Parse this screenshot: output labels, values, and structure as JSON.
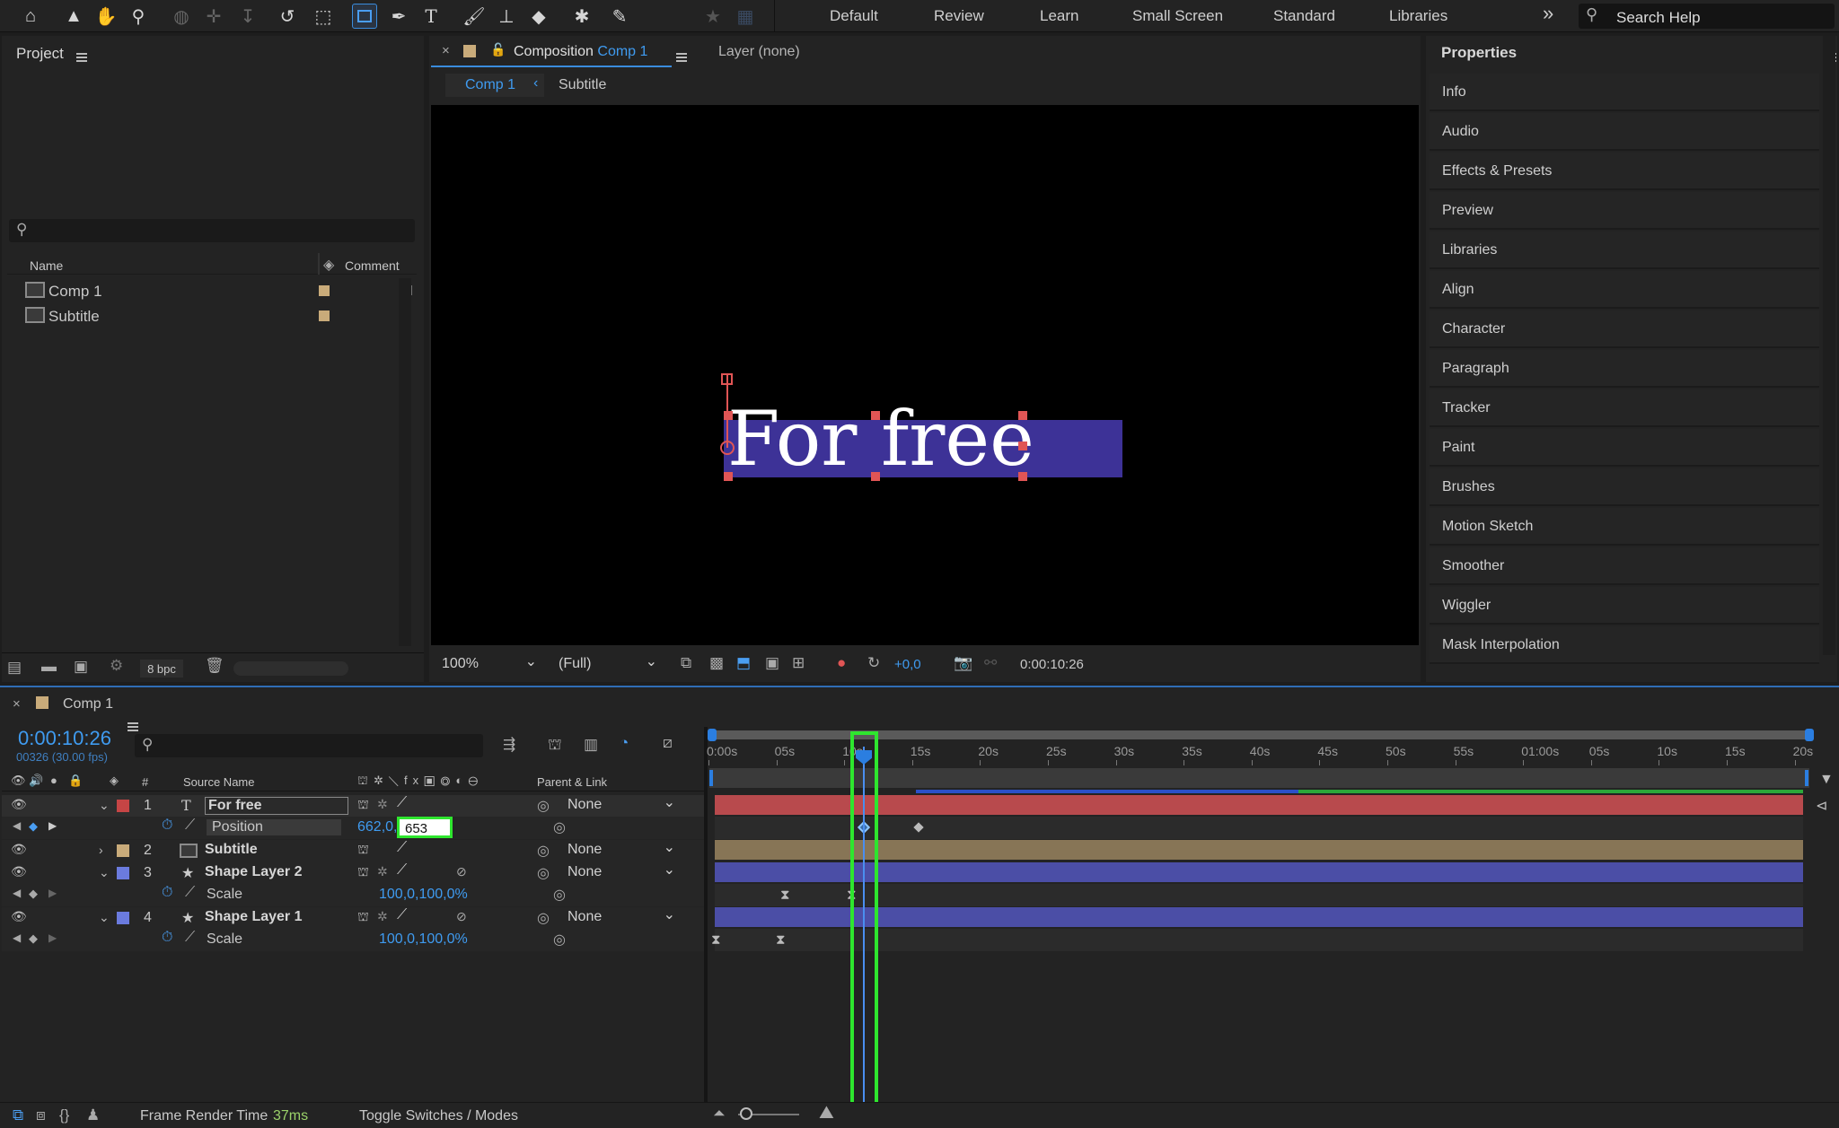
{
  "toolbar": {
    "workspaces": [
      "Default",
      "Review",
      "Learn",
      "Small Screen",
      "Standard",
      "Libraries"
    ],
    "overflow": "»",
    "search_placeholder": "Search Help"
  },
  "project": {
    "title": "Project",
    "col_name": "Name",
    "col_comment": "Comment",
    "items": [
      {
        "name": "Comp 1",
        "color": "#c9ab7a"
      },
      {
        "name": "Subtitle",
        "color": "#c9ab7a"
      }
    ],
    "bpc": "8 bpc"
  },
  "composition": {
    "tab_prefix": "Composition",
    "tab_name": "Comp 1",
    "layer_tab": "Layer (none)",
    "breadcrumb": [
      "Comp 1",
      "Subtitle"
    ],
    "viewer_text": "For free",
    "zoom": "100%",
    "resolution": "(Full)",
    "exposure": "+0,0",
    "timecode": "0:00:10:26"
  },
  "properties": {
    "title": "Properties",
    "items": [
      "Info",
      "Audio",
      "Effects & Presets",
      "Preview",
      "Libraries",
      "Align",
      "Character",
      "Paragraph",
      "Tracker",
      "Paint",
      "Brushes",
      "Motion Sketch",
      "Smoother",
      "Wiggler",
      "Mask Interpolation"
    ]
  },
  "timeline": {
    "comp_name": "Comp 1",
    "timecode": "0:00:10:26",
    "frames": "00326 (30.00 fps)",
    "col_source": "Source Name",
    "col_parent": "Parent & Link",
    "ruler": [
      "0:00s",
      "05s",
      "10s",
      "15s",
      "20s",
      "25s",
      "30s",
      "35s",
      "40s",
      "45s",
      "50s",
      "55s",
      "01:00s",
      "05s",
      "10s",
      "15s",
      "20s"
    ],
    "layers": [
      {
        "num": "1",
        "name": "For free",
        "type": "T",
        "color": "#c64545",
        "parent": "None"
      },
      {
        "prop": "Position",
        "value": "662,0,",
        "edit": "653"
      },
      {
        "num": "2",
        "name": "Subtitle",
        "type": "comp",
        "color": "#c9ab7a",
        "parent": "None"
      },
      {
        "num": "3",
        "name": "Shape Layer 2",
        "type": "★",
        "color": "#6b7bde",
        "parent": "None"
      },
      {
        "prop": "Scale",
        "value": "100,0,100,0%"
      },
      {
        "num": "4",
        "name": "Shape Layer 1",
        "type": "★",
        "color": "#6b7bde",
        "parent": "None"
      },
      {
        "prop": "Scale",
        "value": "100,0,100,0%"
      }
    ],
    "frame_render_label": "Frame Render Time",
    "frame_render_value": "37ms",
    "toggle": "Toggle Switches / Modes"
  }
}
